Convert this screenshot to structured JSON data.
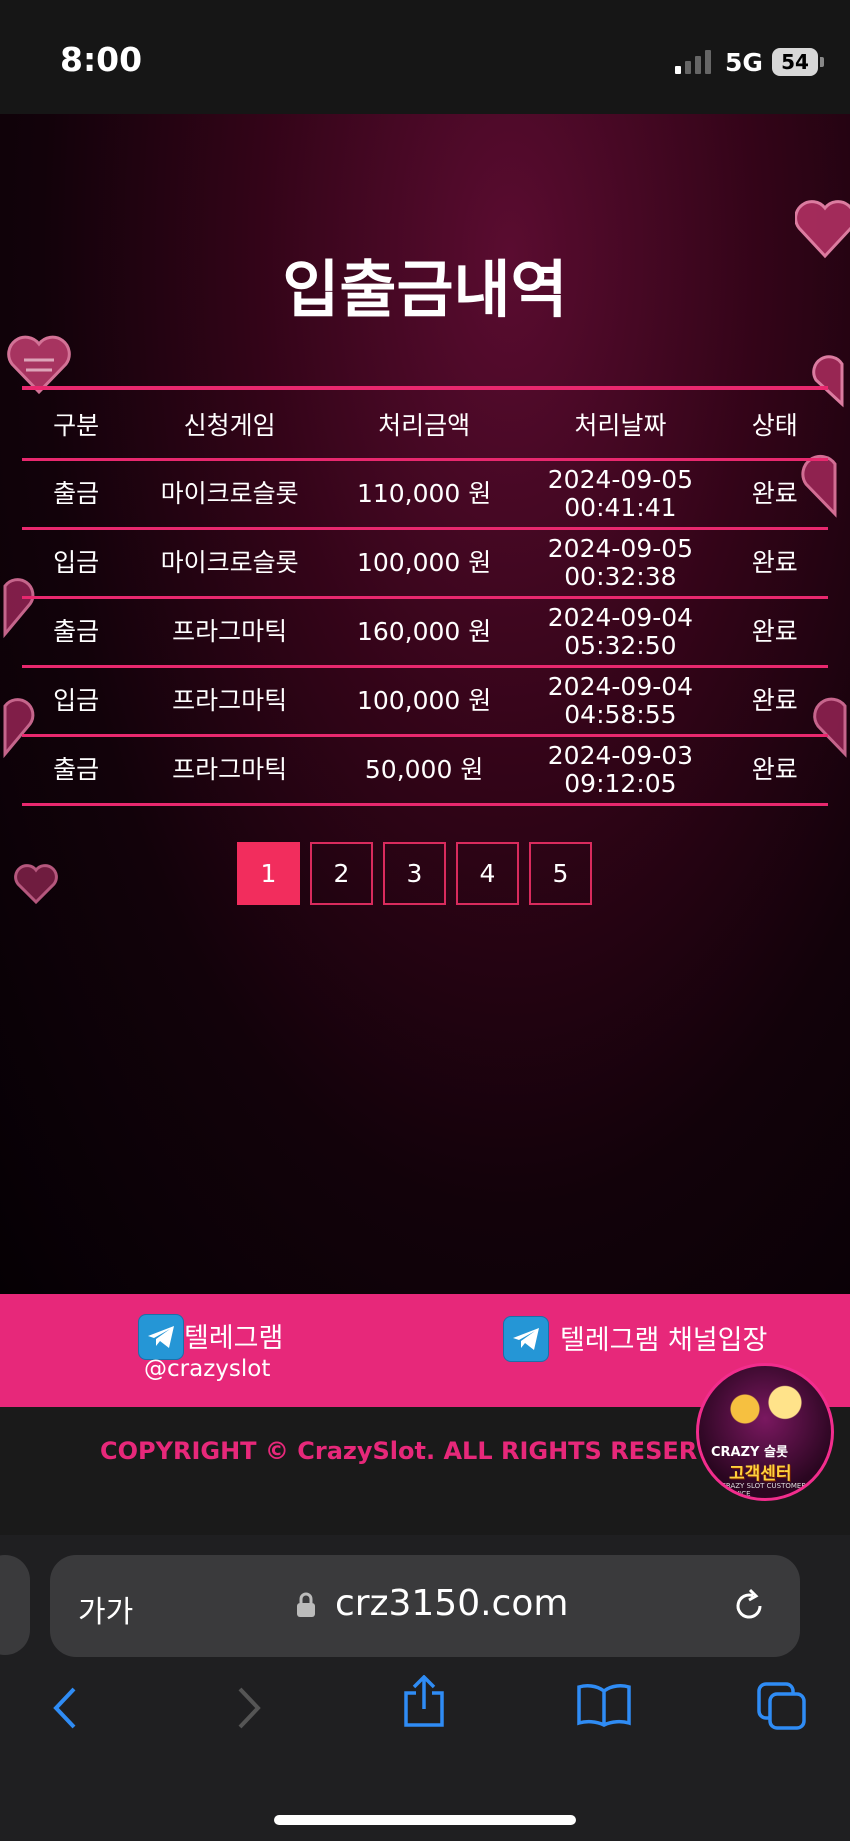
{
  "status_bar": {
    "time": "8:00",
    "network": "5G",
    "battery": "54"
  },
  "page": {
    "title": "입출금내역"
  },
  "table": {
    "headers": [
      "구분",
      "신청게임",
      "처리금액",
      "처리날짜",
      "상태"
    ],
    "rows": [
      {
        "type": "출금",
        "game": "마이크로슬롯",
        "amount": "110,000 원",
        "date": "2024-09-05",
        "time": "00:41:41",
        "status": "완료"
      },
      {
        "type": "입금",
        "game": "마이크로슬롯",
        "amount": "100,000 원",
        "date": "2024-09-05",
        "time": "00:32:38",
        "status": "완료"
      },
      {
        "type": "출금",
        "game": "프라그마틱",
        "amount": "160,000 원",
        "date": "2024-09-04",
        "time": "05:32:50",
        "status": "완료"
      },
      {
        "type": "입금",
        "game": "프라그마틱",
        "amount": "100,000 원",
        "date": "2024-09-04",
        "time": "04:58:55",
        "status": "완료"
      },
      {
        "type": "출금",
        "game": "프라그마틱",
        "amount": "50,000 원",
        "date": "2024-09-03",
        "time": "09:12:05",
        "status": "완료"
      }
    ]
  },
  "pagination": {
    "pages": [
      "1",
      "2",
      "3",
      "4",
      "5"
    ],
    "current": "1"
  },
  "footer": {
    "telegram_label": "텔레그램",
    "telegram_handle": "@crazyslot",
    "telegram_channel": "텔레그램 채널입장",
    "copyright": "COPYRIGHT © CrazySlot. ALL RIGHTS RESERVED"
  },
  "support_badge": {
    "top_text": "CRAZY 슬롯",
    "title": "고객센터",
    "subtitle": "CRAZY SLOT CUSTOMER SERVICE"
  },
  "browser": {
    "text_size_label": "가가",
    "url": "crz3150.com"
  },
  "colors": {
    "accent": "#e7287a",
    "active_page": "#f22d5d",
    "row_border": "#e8286e"
  },
  "icons": [
    "telegram-icon",
    "lock-icon",
    "reload-icon",
    "back-icon",
    "forward-icon",
    "share-icon",
    "bookmarks-icon",
    "tabs-icon"
  ]
}
